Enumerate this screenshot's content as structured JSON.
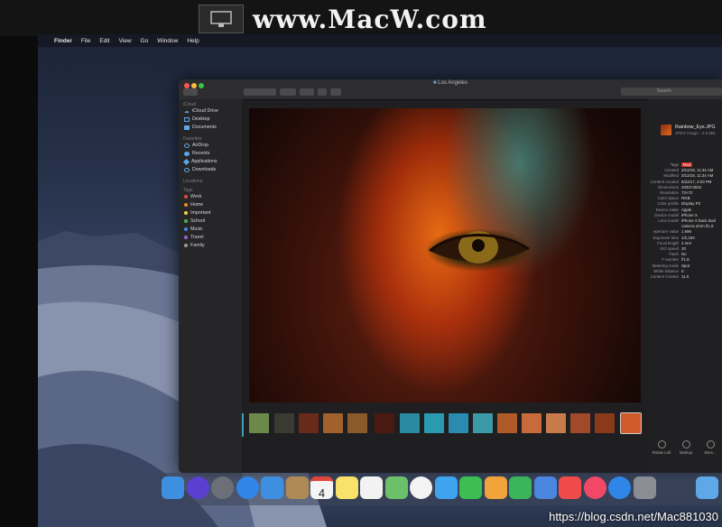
{
  "watermark": {
    "site": "www.MacW.com",
    "footer": "https://blog.csdn.net/Mac881030"
  },
  "menubar": {
    "apple": "",
    "items": [
      "Finder",
      "File",
      "Edit",
      "View",
      "Go",
      "Window",
      "Help"
    ]
  },
  "window": {
    "title": "Los Angeles",
    "search_placeholder": "Search"
  },
  "sidebar": {
    "sections": [
      {
        "title": "iCloud",
        "items": [
          {
            "label": "iCloud Drive",
            "icon": "cloud-icon"
          },
          {
            "label": "Desktop",
            "icon": "desktop-icon"
          },
          {
            "label": "Documents",
            "icon": "document-icon"
          }
        ]
      },
      {
        "title": "Favorites",
        "items": [
          {
            "label": "AirDrop",
            "icon": "airdrop-icon"
          },
          {
            "label": "Recents",
            "icon": "clock-icon"
          },
          {
            "label": "Applications",
            "icon": "applications-icon"
          },
          {
            "label": "Downloads",
            "icon": "download-icon"
          }
        ]
      },
      {
        "title": "Locations",
        "items": []
      },
      {
        "title": "Tags",
        "items": [
          {
            "label": "Work",
            "color": "#e0473c"
          },
          {
            "label": "Home",
            "color": "#f08a24"
          },
          {
            "label": "Important",
            "color": "#f4d23c"
          },
          {
            "label": "School",
            "color": "#46b64a"
          },
          {
            "label": "Music",
            "color": "#3a8ee6"
          },
          {
            "label": "Travel",
            "color": "#a25fd6"
          },
          {
            "label": "Family",
            "color": "#9a9a9a"
          }
        ]
      }
    ]
  },
  "inspector": {
    "file_name": "Rainbow_Eye.JPG",
    "file_kind": "JPEG image - 2.6 MB",
    "metadata": [
      {
        "k": "Tags",
        "v": "Red"
      },
      {
        "k": "Created",
        "v": "3/12/18, 11:34 AM"
      },
      {
        "k": "Modified",
        "v": "3/12/18, 11:34 AM"
      },
      {
        "k": "Content created",
        "v": "8/22/17, 4:03 PM"
      },
      {
        "k": "Dimensions",
        "v": "4032×3024"
      },
      {
        "k": "Resolution",
        "v": "72×72"
      },
      {
        "k": "Color space",
        "v": "RGB"
      },
      {
        "k": "Color profile",
        "v": "Display P3"
      },
      {
        "k": "Device make",
        "v": "Apple"
      },
      {
        "k": "Device model",
        "v": "iPhone X"
      },
      {
        "k": "Lens model",
        "v": "iPhone X back dual"
      },
      {
        "k": "",
        "v": "camera 4mm f/1.8"
      },
      {
        "k": "Aperture value",
        "v": "1.696"
      },
      {
        "k": "Exposure time",
        "v": "1/2,183"
      },
      {
        "k": "Focal length",
        "v": "4 mm"
      },
      {
        "k": "ISO speed",
        "v": "20"
      },
      {
        "k": "Flash",
        "v": "No"
      },
      {
        "k": "F number",
        "v": "f/1.8"
      },
      {
        "k": "Metering mode",
        "v": "Spot"
      },
      {
        "k": "White balance",
        "v": "0"
      },
      {
        "k": "Content Creator",
        "v": "11.0"
      }
    ],
    "actions": [
      {
        "label": "Rotate Left",
        "icon": "rotate-left-icon"
      },
      {
        "label": "Markup",
        "icon": "markup-icon"
      },
      {
        "label": "More...",
        "icon": "more-icon"
      }
    ]
  },
  "dock": {
    "apps": [
      {
        "name": "finder-icon",
        "color": "#3f8fe0"
      },
      {
        "name": "siri-icon",
        "color": "#5a3fd0"
      },
      {
        "name": "launchpad-icon",
        "color": "#6c6f78"
      },
      {
        "name": "safari-icon",
        "color": "#2f86e8"
      },
      {
        "name": "mail-icon",
        "color": "#3f8fe0"
      },
      {
        "name": "contacts-icon",
        "color": "#b08a55"
      },
      {
        "name": "calendar-icon",
        "color": "#f4f4f4"
      },
      {
        "name": "notes-icon",
        "color": "#f8e26a"
      },
      {
        "name": "reminders-icon",
        "color": "#f2f2f2"
      },
      {
        "name": "maps-icon",
        "color": "#6cc06a"
      },
      {
        "name": "photos-icon",
        "color": "#f3f3f3"
      },
      {
        "name": "messages-icon",
        "color": "#3ea4f0"
      },
      {
        "name": "facetime-icon",
        "color": "#3dbe52"
      },
      {
        "name": "pages-icon",
        "color": "#f1a33b"
      },
      {
        "name": "numbers-icon",
        "color": "#3cb45a"
      },
      {
        "name": "keynote-icon",
        "color": "#4a86e0"
      },
      {
        "name": "news-icon",
        "color": "#f04a4a"
      },
      {
        "name": "music-icon",
        "color": "#f24868"
      },
      {
        "name": "app-store-icon",
        "color": "#2f86e8"
      },
      {
        "name": "system-preferences-icon",
        "color": "#8a8d93"
      },
      {
        "name": "downloads-folder-icon",
        "color": "#5ea8e8"
      }
    ],
    "calendar_day": "4"
  },
  "filmstrip": {
    "thumbs": [
      "#6b8a4a",
      "#3a3a30",
      "#6a2a1a",
      "#a0622a",
      "#8a5a2a",
      "#4a1a10",
      "#2a8aa0",
      "#2a9ab0",
      "#2a8ab0",
      "#3a9aa8",
      "#b05a2a",
      "#c86a3a",
      "#c87a4a",
      "#a04a2a",
      "#8a3a1a",
      "#d05a2a"
    ]
  }
}
